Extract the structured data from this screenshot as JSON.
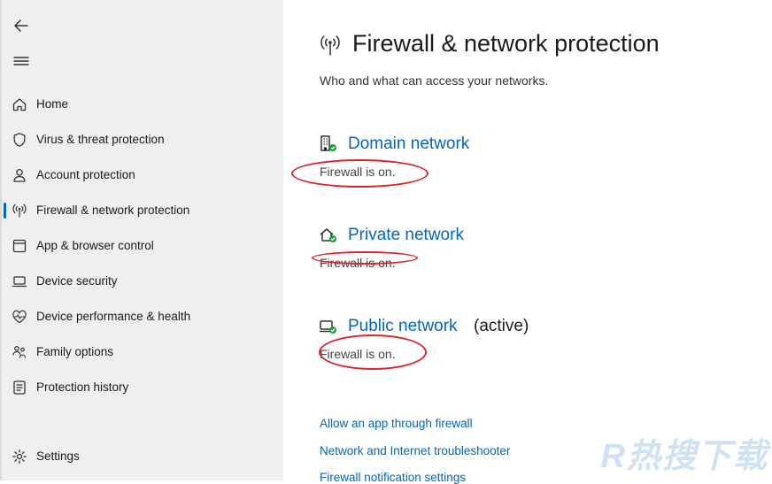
{
  "sidebar": {
    "items": [
      {
        "label": "Home",
        "icon": "home-icon"
      },
      {
        "label": "Virus & threat protection",
        "icon": "shield-icon"
      },
      {
        "label": "Account protection",
        "icon": "person-icon"
      },
      {
        "label": "Firewall & network protection",
        "icon": "antenna-icon",
        "active": true
      },
      {
        "label": "App & browser control",
        "icon": "app-window-icon"
      },
      {
        "label": "Device security",
        "icon": "laptop-icon"
      },
      {
        "label": "Device performance & health",
        "icon": "heart-pulse-icon"
      },
      {
        "label": "Family options",
        "icon": "family-icon"
      },
      {
        "label": "Protection history",
        "icon": "history-icon"
      }
    ],
    "settings_label": "Settings"
  },
  "main": {
    "title": "Firewall & network protection",
    "subtitle": "Who and what can access your networks.",
    "networks": [
      {
        "name": "Domain network",
        "status": "Firewall is on.",
        "icon": "domain-network-icon"
      },
      {
        "name": "Private network",
        "status": "Firewall is on.",
        "icon": "private-network-icon"
      },
      {
        "name": "Public network",
        "status": "Firewall is on.",
        "active_label": "(active)",
        "icon": "public-network-icon"
      }
    ],
    "links": [
      "Allow an app through firewall",
      "Network and Internet troubleshooter",
      "Firewall notification settings"
    ]
  },
  "watermark": "R热搜下载",
  "colors": {
    "accent": "#0067c0",
    "ok_green": "#1f9d3a",
    "annotation_red": "#d8262b",
    "sidebar_bg": "#efefef"
  }
}
